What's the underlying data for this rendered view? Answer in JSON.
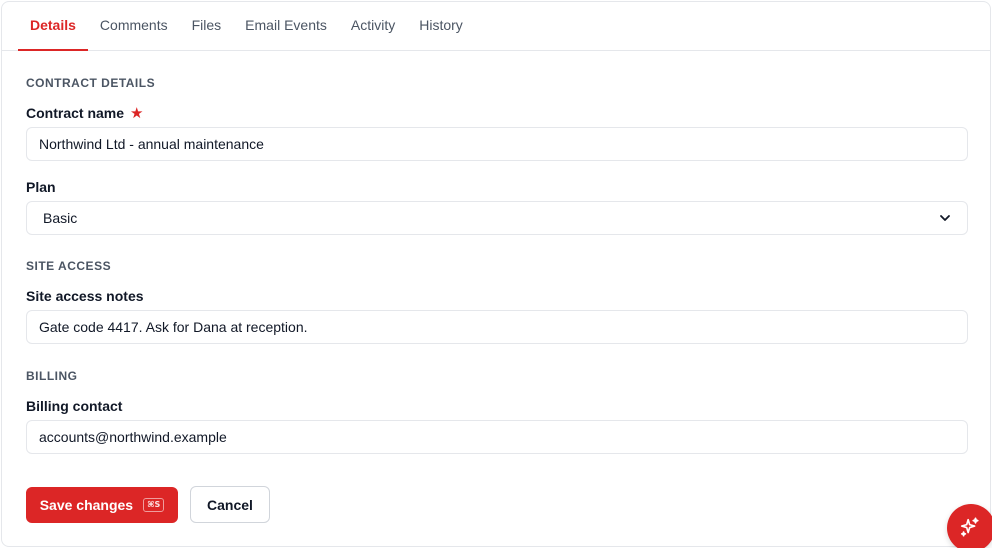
{
  "tabs": [
    {
      "label": "Details",
      "active": true
    },
    {
      "label": "Comments",
      "active": false
    },
    {
      "label": "Files",
      "active": false
    },
    {
      "label": "Email Events",
      "active": false
    },
    {
      "label": "Activity",
      "active": false
    },
    {
      "label": "History",
      "active": false
    }
  ],
  "sections": {
    "contract": {
      "title": "CONTRACT DETAILS",
      "name_label": "Contract name",
      "name_value": "Northwind Ltd - annual maintenance",
      "required_icon": "★",
      "plan_label": "Plan",
      "plan_value": "Basic"
    },
    "site": {
      "title": "SITE ACCESS",
      "notes_label": "Site access notes",
      "notes_value": "Gate code 4417. Ask for Dana at reception."
    },
    "billing": {
      "title": "BILLING",
      "contact_label": "Billing contact",
      "contact_value": "accounts@northwind.example"
    }
  },
  "actions": {
    "save_label": "Save changes",
    "save_shortcut": "⌘S",
    "cancel_label": "Cancel"
  },
  "colors": {
    "accent": "#dc2626",
    "border": "#e5e7eb",
    "muted_text": "#4b5563"
  },
  "icons": {
    "required": "star-icon",
    "select": "chevron-down-icon",
    "fab": "sparkles-icon"
  }
}
